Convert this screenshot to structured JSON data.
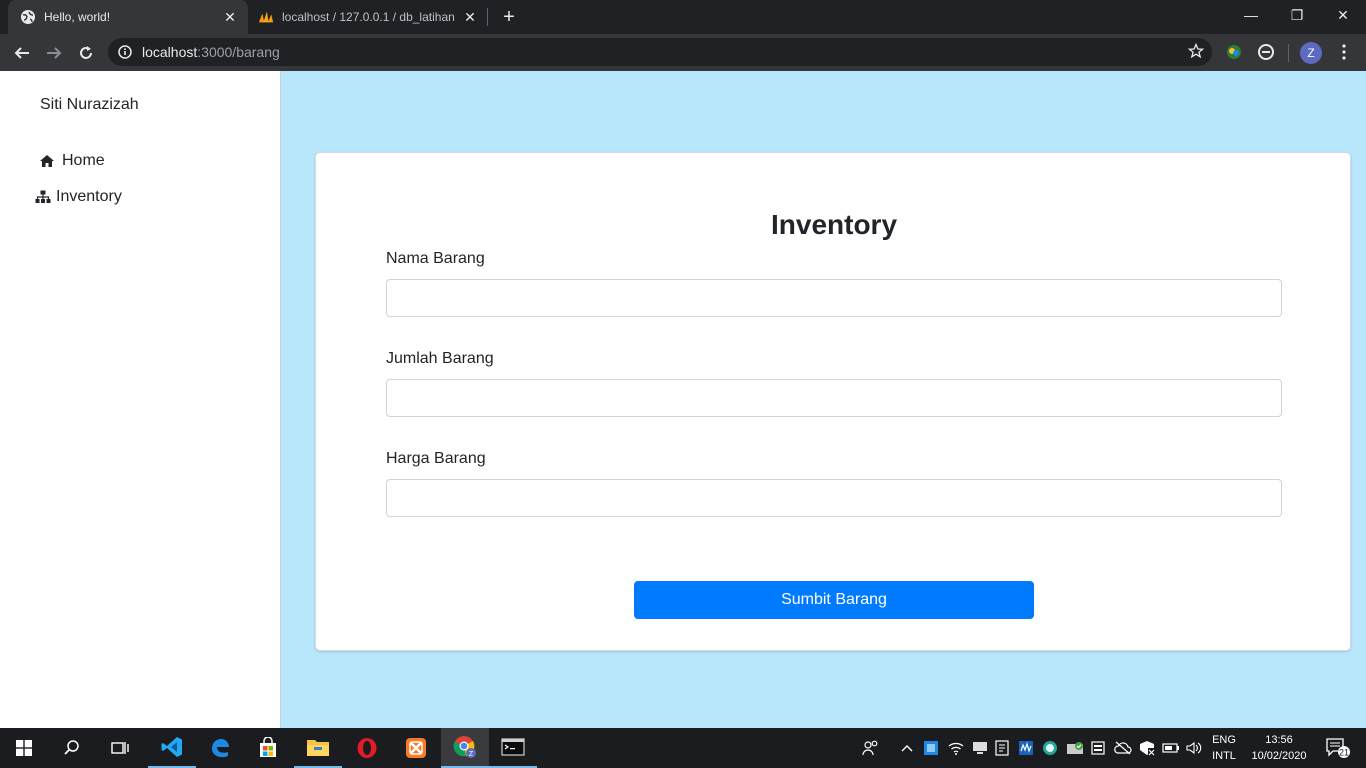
{
  "browser": {
    "tabs": [
      {
        "title": "Hello, world!",
        "active": true
      },
      {
        "title": "localhost / 127.0.0.1 / db_latihan",
        "active": false
      }
    ],
    "url_host": "localhost",
    "url_path": ":3000/barang",
    "profile_initial": "Z"
  },
  "sidebar": {
    "brand": "Siti Nurazizah",
    "items": [
      {
        "label": "Home",
        "icon": "home-icon"
      },
      {
        "label": "Inventory",
        "icon": "sitemap-icon"
      }
    ]
  },
  "form": {
    "title": "Inventory",
    "fields": [
      {
        "label": "Nama Barang",
        "value": ""
      },
      {
        "label": "Jumlah Barang",
        "value": ""
      },
      {
        "label": "Harga Barang",
        "value": ""
      }
    ],
    "submit_label": "Sumbit Barang"
  },
  "taskbar": {
    "apps": [
      "start-icon",
      "search-icon",
      "task-view-icon",
      "vscode-icon",
      "edge-icon",
      "store-icon",
      "file-explorer-icon",
      "opera-icon",
      "xampp-icon",
      "chrome-icon",
      "terminal-icon"
    ],
    "lang_line1": "ENG",
    "lang_line2": "INTL",
    "time": "13:56",
    "date": "10/02/2020",
    "notifications": "21"
  },
  "colors": {
    "page_bg": "#b8e6fb",
    "button": "#007bff",
    "chrome_dark": "#202124",
    "chrome_toolbar": "#35363a"
  }
}
